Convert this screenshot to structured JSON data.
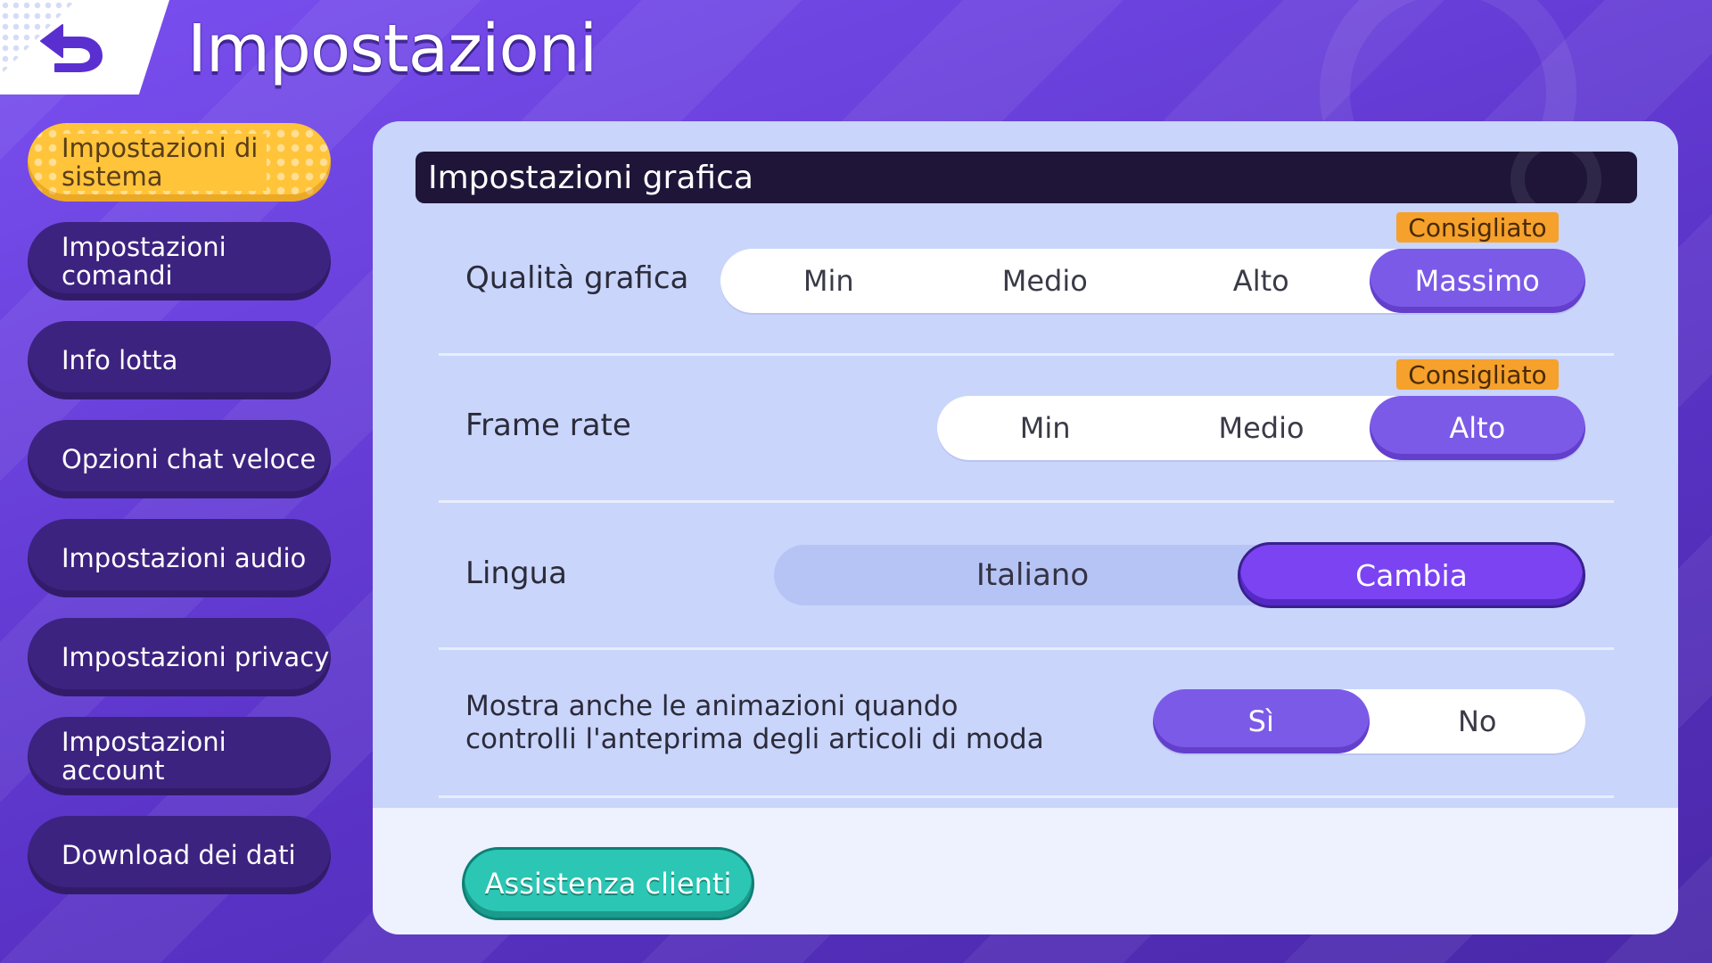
{
  "header": {
    "title": "Impostazioni",
    "back_icon": "back-arrow-icon"
  },
  "sidebar": {
    "items": [
      {
        "label": "Impostazioni di sistema",
        "active": true
      },
      {
        "label": "Impostazioni comandi",
        "active": false
      },
      {
        "label": "Info lotta",
        "active": false
      },
      {
        "label": "Opzioni chat veloce",
        "active": false
      },
      {
        "label": "Impostazioni audio",
        "active": false
      },
      {
        "label": "Impostazioni privacy",
        "active": false
      },
      {
        "label": "Impostazioni account",
        "active": false
      },
      {
        "label": "Download dei dati",
        "active": false
      }
    ]
  },
  "main": {
    "section_title": "Impostazioni grafica",
    "graphics_quality": {
      "label": "Qualità grafica",
      "badge": "Consigliato",
      "options": [
        "Min",
        "Medio",
        "Alto",
        "Massimo"
      ],
      "selected": "Massimo"
    },
    "frame_rate": {
      "label": "Frame rate",
      "badge": "Consigliato",
      "options": [
        "Min",
        "Medio",
        "Alto"
      ],
      "selected": "Alto"
    },
    "language": {
      "label": "Lingua",
      "value": "Italiano",
      "change_label": "Cambia"
    },
    "animations": {
      "label": "Mostra anche le animazioni quando controlli l'anteprima degli articoli di moda",
      "options": [
        "Sì",
        "No"
      ],
      "selected": "Sì"
    },
    "support_button": "Assistenza clienti"
  },
  "colors": {
    "accent_purple": "#7b5ae8",
    "active_tab_yellow": "#ffc43a",
    "badge_orange": "#f5a12c",
    "support_teal": "#2cc6b4"
  }
}
